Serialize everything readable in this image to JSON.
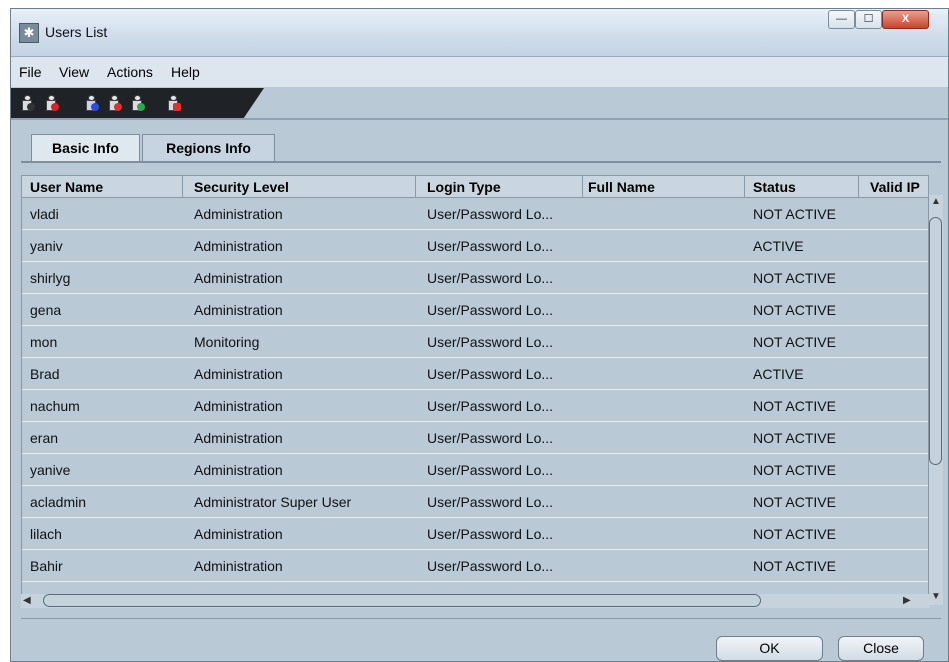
{
  "window": {
    "title": "Users List",
    "min_glyph": "—",
    "max_glyph": "☐",
    "close_glyph": "X"
  },
  "menu": [
    "File",
    "View",
    "Actions",
    "Help"
  ],
  "toolbar": {
    "icons": [
      "add-user-icon",
      "delete-user-icon",
      "copy-user-icon",
      "disable-user-icon",
      "refresh-user-icon",
      "lock-user-icon"
    ]
  },
  "tabs": [
    {
      "label": "Basic Info",
      "selected": true
    },
    {
      "label": "Regions Info",
      "selected": false
    }
  ],
  "table": {
    "columns": [
      "User Name",
      "Security Level",
      "Login Type",
      "Full Name",
      "Status",
      "Valid IP"
    ],
    "rows": [
      [
        "vladi",
        "Administration",
        "User/Password Lo...",
        "",
        "NOT ACTIVE",
        ""
      ],
      [
        "yaniv",
        "Administration",
        "User/Password Lo...",
        "",
        "ACTIVE",
        ""
      ],
      [
        "shirlyg",
        "Administration",
        "User/Password Lo...",
        "",
        "NOT ACTIVE",
        ""
      ],
      [
        "gena",
        "Administration",
        "User/Password Lo...",
        "",
        "NOT ACTIVE",
        ""
      ],
      [
        "mon",
        "Monitoring",
        "User/Password Lo...",
        "",
        "NOT ACTIVE",
        ""
      ],
      [
        "Brad",
        "Administration",
        "User/Password Lo...",
        "",
        "ACTIVE",
        ""
      ],
      [
        "nachum",
        "Administration",
        "User/Password Lo...",
        "",
        "NOT ACTIVE",
        ""
      ],
      [
        "eran",
        "Administration",
        "User/Password Lo...",
        "",
        "NOT ACTIVE",
        ""
      ],
      [
        "yanive",
        "Administration",
        "User/Password Lo...",
        "",
        "NOT ACTIVE",
        ""
      ],
      [
        "acladmin",
        "Administrator Super User",
        "User/Password Lo...",
        "",
        "NOT ACTIVE",
        ""
      ],
      [
        "lilach",
        "Administration",
        "User/Password Lo...",
        "",
        "NOT ACTIVE",
        ""
      ],
      [
        "Bahir",
        "Administration",
        "User/Password Lo...",
        "",
        "NOT ACTIVE",
        ""
      ]
    ]
  },
  "buttons": {
    "ok": "OK",
    "close": "Close"
  },
  "colors": {
    "background": "#b9cad6",
    "toolbar": "#1f2328",
    "header": "#c9d6e0"
  }
}
